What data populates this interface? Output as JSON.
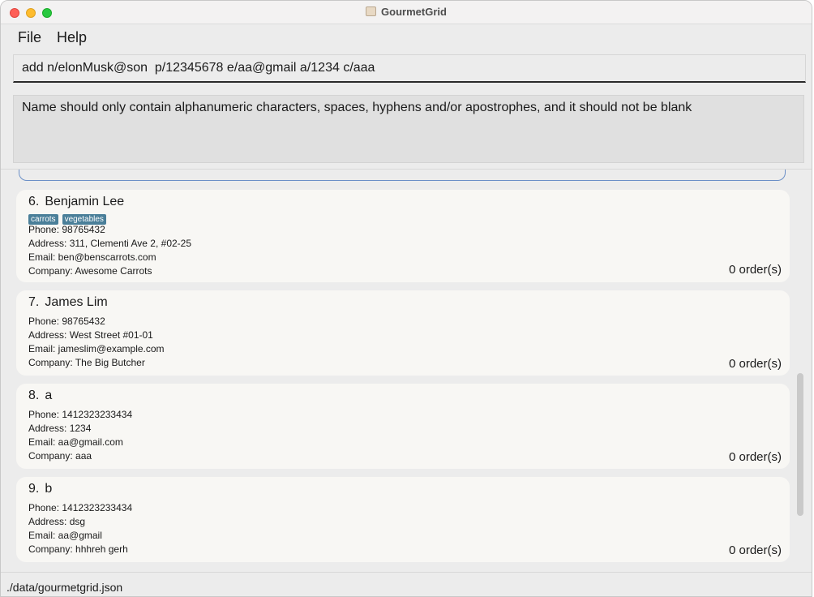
{
  "window": {
    "title": "GourmetGrid"
  },
  "menu": {
    "items": [
      "File",
      "Help"
    ]
  },
  "command": {
    "value": "add n/elonMusk@son  p/12345678 e/aa@gmail a/1234 c/aaa"
  },
  "result": {
    "text": "Name should only contain alphanumeric characters, spaces, hyphens and/or apostrophes, and it should not be blank"
  },
  "cards": [
    {
      "index": "6.",
      "name": "Benjamin Lee",
      "tags": [
        "carrots",
        "vegetables"
      ],
      "phone": "Phone: 98765432",
      "address": "Address: 311, Clementi Ave 2, #02-25",
      "email": "Email: ben@benscarrots.com",
      "company": "Company: Awesome Carrots",
      "orders": "0 order(s)"
    },
    {
      "index": "7.",
      "name": "James Lim",
      "tags": [],
      "phone": "Phone: 98765432",
      "address": "Address: West Street #01-01",
      "email": "Email: jameslim@example.com",
      "company": "Company: The Big Butcher",
      "orders": "0 order(s)"
    },
    {
      "index": "8.",
      "name": "a",
      "tags": [],
      "phone": "Phone: 1412323233434",
      "address": "Address: 1234",
      "email": "Email: aa@gmail.com",
      "company": "Company: aaa",
      "orders": "0 order(s)"
    },
    {
      "index": "9.",
      "name": "b",
      "tags": [],
      "phone": "Phone: 1412323233434",
      "address": "Address: dsg",
      "email": "Email: aa@gmail",
      "company": "Company: hhhreh gerh",
      "orders": "0 order(s)"
    }
  ],
  "status": {
    "path": "./data/gourmetgrid.json"
  },
  "colors": {
    "tag_bg": "#4a7f99",
    "card_bg": "#f8f7f4",
    "window_bg": "#ececec"
  },
  "icons": [
    "close-icon",
    "minimize-icon",
    "maximize-icon",
    "app-icon"
  ]
}
